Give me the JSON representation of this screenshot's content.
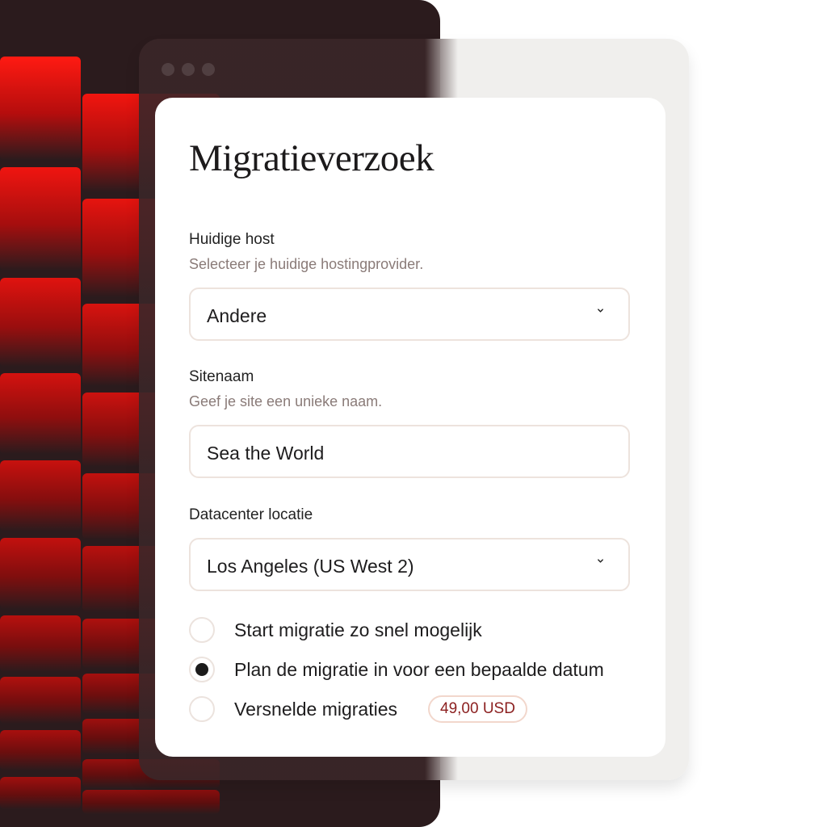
{
  "form": {
    "title": "Migratieverzoek",
    "host": {
      "label": "Huidige host",
      "hint": "Selecteer je huidige hostingprovider.",
      "value": "Andere",
      "icon": "chevron-down-icon"
    },
    "site": {
      "label": "Sitenaam",
      "hint": "Geef je site een unieke naam.",
      "value": "Sea the World"
    },
    "datacenter": {
      "label": "Datacenter locatie",
      "value": "Los Angeles (US West 2)",
      "icon": "chevron-down-icon"
    },
    "options": [
      {
        "label": "Start migratie zo snel mogelijk",
        "selected": false
      },
      {
        "label": "Plan de migratie in voor een bepaalde datum",
        "selected": true
      },
      {
        "label": "Versnelde migraties",
        "selected": false,
        "price": "49,00 USD"
      }
    ]
  },
  "colors": {
    "accent_red": "#e0100f",
    "dark_panel": "#2b1b1d",
    "price_text": "#8b1f1f"
  }
}
